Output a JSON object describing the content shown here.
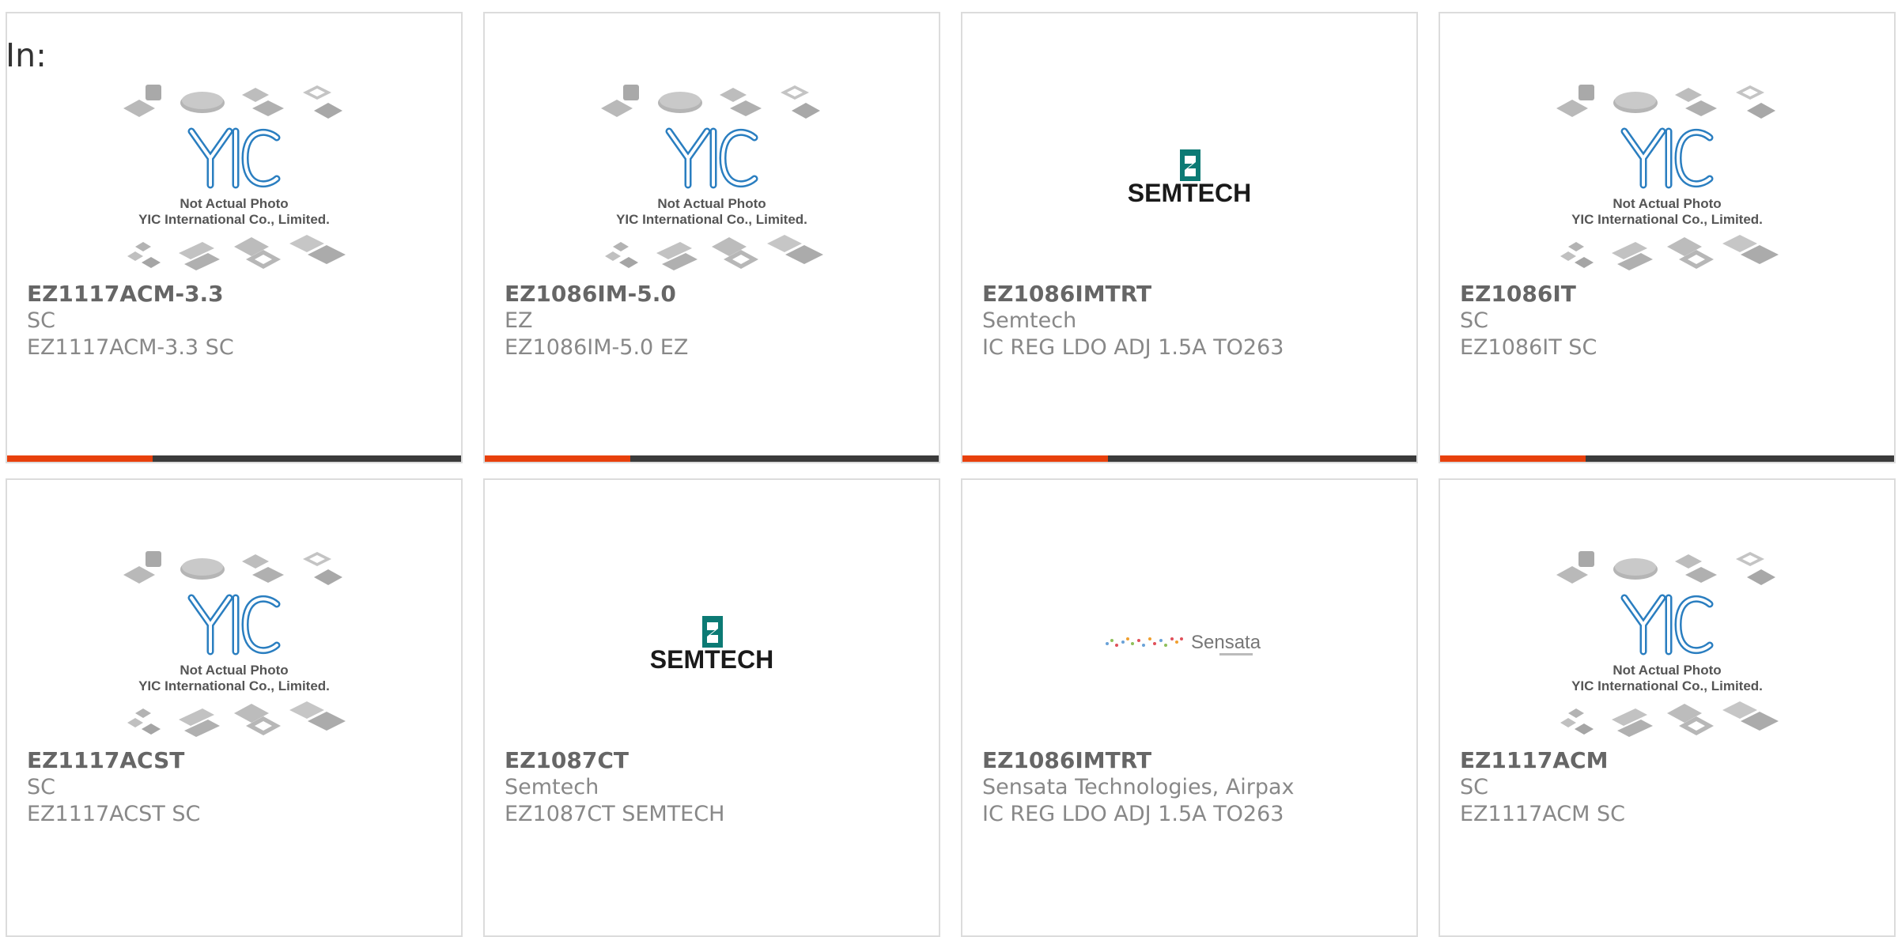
{
  "page": {
    "label": "In:"
  },
  "colors": {
    "accent": "#e8400c",
    "bar": "#3b3b3b",
    "yic_blue": "#2a7ec0",
    "semtech_teal": "#0c7a74"
  },
  "placeholder": {
    "line1": "Not Actual Photo",
    "line2": "YIC International Co., Limited."
  },
  "products": [
    {
      "part_number": "EZ1117ACM-3.3",
      "manufacturer": "SC",
      "description": "EZ1117ACM-3.3 SC",
      "image": "yic-placeholder-icon"
    },
    {
      "part_number": "EZ1086IM-5.0",
      "manufacturer": "EZ",
      "description": "EZ1086IM-5.0 EZ",
      "image": "yic-placeholder-icon"
    },
    {
      "part_number": "EZ1086IMTRT",
      "manufacturer": "Semtech",
      "description": "IC REG LDO ADJ 1.5A TO263",
      "image": "semtech-logo",
      "logo_text": "SEMTECH"
    },
    {
      "part_number": "EZ1086IT",
      "manufacturer": "SC",
      "description": "EZ1086IT SC",
      "image": "yic-placeholder-icon"
    },
    {
      "part_number": "EZ1117ACST",
      "manufacturer": "SC",
      "description": "EZ1117ACST SC",
      "image": "yic-placeholder-icon"
    },
    {
      "part_number": "EZ1087CT",
      "manufacturer": "Semtech",
      "description": "EZ1087CT SEMTECH",
      "image": "semtech-logo",
      "logo_text": "SEMTECH"
    },
    {
      "part_number": "EZ1086IMTRT",
      "manufacturer": "Sensata Technologies, Airpax",
      "description": "IC REG LDO ADJ 1.5A TO263",
      "image": "sensata-logo",
      "logo_text": "Sensata"
    },
    {
      "part_number": "EZ1117ACM",
      "manufacturer": "SC",
      "description": "EZ1117ACM SC",
      "image": "yic-placeholder-icon"
    }
  ]
}
